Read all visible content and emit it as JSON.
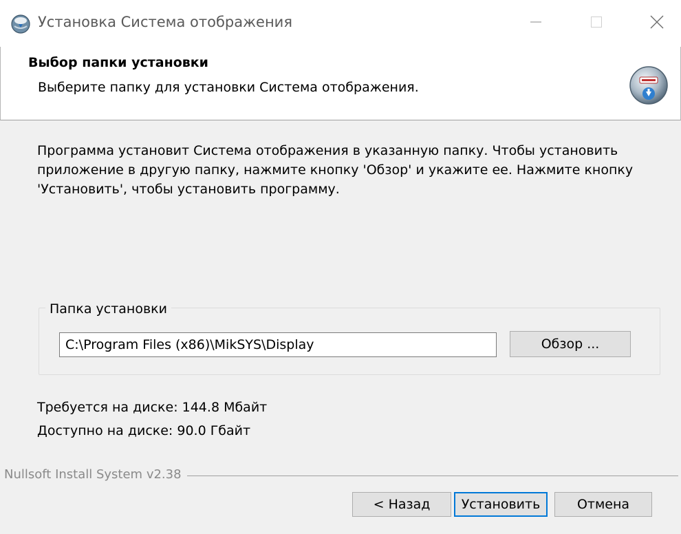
{
  "window": {
    "title": "Установка Система отображения",
    "icon": "installer-globe-icon",
    "controls": [
      "minimize-icon",
      "maximize-icon",
      "close-icon"
    ]
  },
  "header": {
    "title": "Выбор папки установки",
    "subtitle": "Выберите папку для установки Система отображения.",
    "logo": "installer-disc-download-icon"
  },
  "body": {
    "description": "Программа установит Система отображения в указанную папку. Чтобы установить приложение в другую папку, нажмите кнопку 'Обзор' и укажите ее. Нажмите кнопку 'Установить', чтобы установить программу.",
    "group_label": "Папка установки",
    "install_path": "C:\\Program Files (x86)\\MikSYS\\Display",
    "browse_label": "Обзор ...",
    "space_required": "Требуется на диске: 144.8 Мбайт",
    "space_available": "Доступно на диске: 90.0 Гбайт"
  },
  "footer": {
    "branding": "Nullsoft Install System v2.38",
    "back_label": "< Назад",
    "install_label": "Установить",
    "cancel_label": "Отмена"
  },
  "colors": {
    "accent": "#0078d7",
    "window_bg": "#f0f0f0",
    "header_bg": "#ffffff"
  }
}
